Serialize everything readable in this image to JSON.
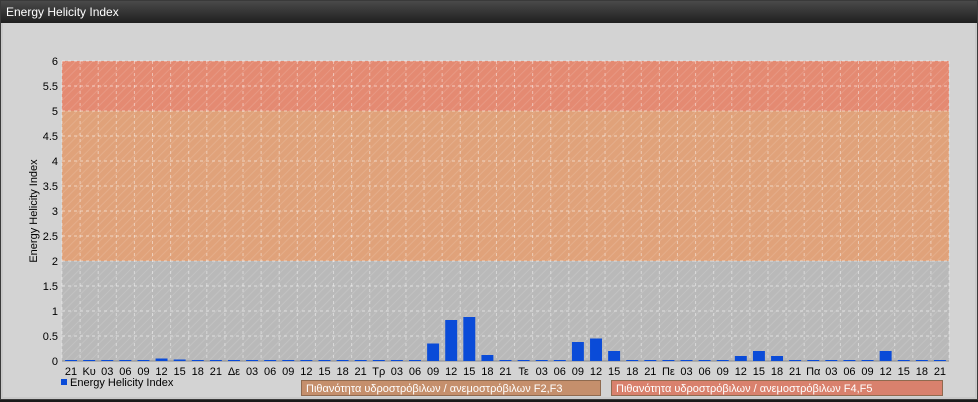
{
  "window": {
    "title": "Energy Helicity Index"
  },
  "legend": {
    "series_label": "Energy Helicity Index",
    "band_f2f3": "Πιθανότητα υδροστρόβιλων / ανεμοστρόβιλων F2,F3",
    "band_f4f5": "Πιθανότητα υδροστρόβιλων / ανεμοστρόβιλων F4,F5"
  },
  "colors": {
    "bar": "#0a4bd8",
    "band_low": "#b9b9b9",
    "band_mid": "#e0a27a",
    "band_high": "#e48a72",
    "legend_f2f3": "#c58f6c",
    "legend_f4f5": "#d9816d"
  },
  "chart_data": {
    "type": "bar",
    "title": "Energy Helicity Index",
    "ylabel": "Energy Helicity Index",
    "xlabel": "",
    "ylim": [
      0,
      6
    ],
    "yticks": [
      "0",
      "0.5",
      "1",
      "1.5",
      "2",
      "2.5",
      "3",
      "3.5",
      "4",
      "4.5",
      "5",
      "5.5",
      "6"
    ],
    "grid": true,
    "legend_placement": "bottom-left",
    "bands": [
      {
        "from": 0,
        "to": 2,
        "label": ""
      },
      {
        "from": 2,
        "to": 5,
        "label": "Πιθανότητα υδροστρόβιλων / ανεμοστρόβιλων F2,F3"
      },
      {
        "from": 5,
        "to": 6,
        "label": "Πιθανότητα υδροστρόβιλων / ανεμοστρόβιλων F4,F5"
      }
    ],
    "categories": [
      "21",
      "Κυ",
      "03",
      "06",
      "09",
      "12",
      "15",
      "18",
      "21",
      "Δε",
      "03",
      "06",
      "09",
      "12",
      "15",
      "18",
      "21",
      "Τρ",
      "03",
      "06",
      "09",
      "12",
      "15",
      "18",
      "21",
      "Τε",
      "03",
      "06",
      "09",
      "12",
      "15",
      "18",
      "21",
      "Πε",
      "03",
      "06",
      "09",
      "12",
      "15",
      "18",
      "21",
      "Πα",
      "03",
      "06",
      "09",
      "12",
      "15",
      "18",
      "21"
    ],
    "series": [
      {
        "name": "Energy Helicity Index",
        "values": [
          0.02,
          0.02,
          0.02,
          0.02,
          0.02,
          0.05,
          0.03,
          0.02,
          0.02,
          0.02,
          0.02,
          0.02,
          0.02,
          0.02,
          0.02,
          0.02,
          0.02,
          0.02,
          0.02,
          0.02,
          0.35,
          0.82,
          0.88,
          0.12,
          0.02,
          0.02,
          0.02,
          0.02,
          0.38,
          0.45,
          0.2,
          0.02,
          0.02,
          0.02,
          0.02,
          0.02,
          0.02,
          0.1,
          0.2,
          0.1,
          0.02,
          0.02,
          0.02,
          0.02,
          0.02,
          0.2,
          0.02,
          0.02,
          0.02
        ]
      }
    ]
  }
}
